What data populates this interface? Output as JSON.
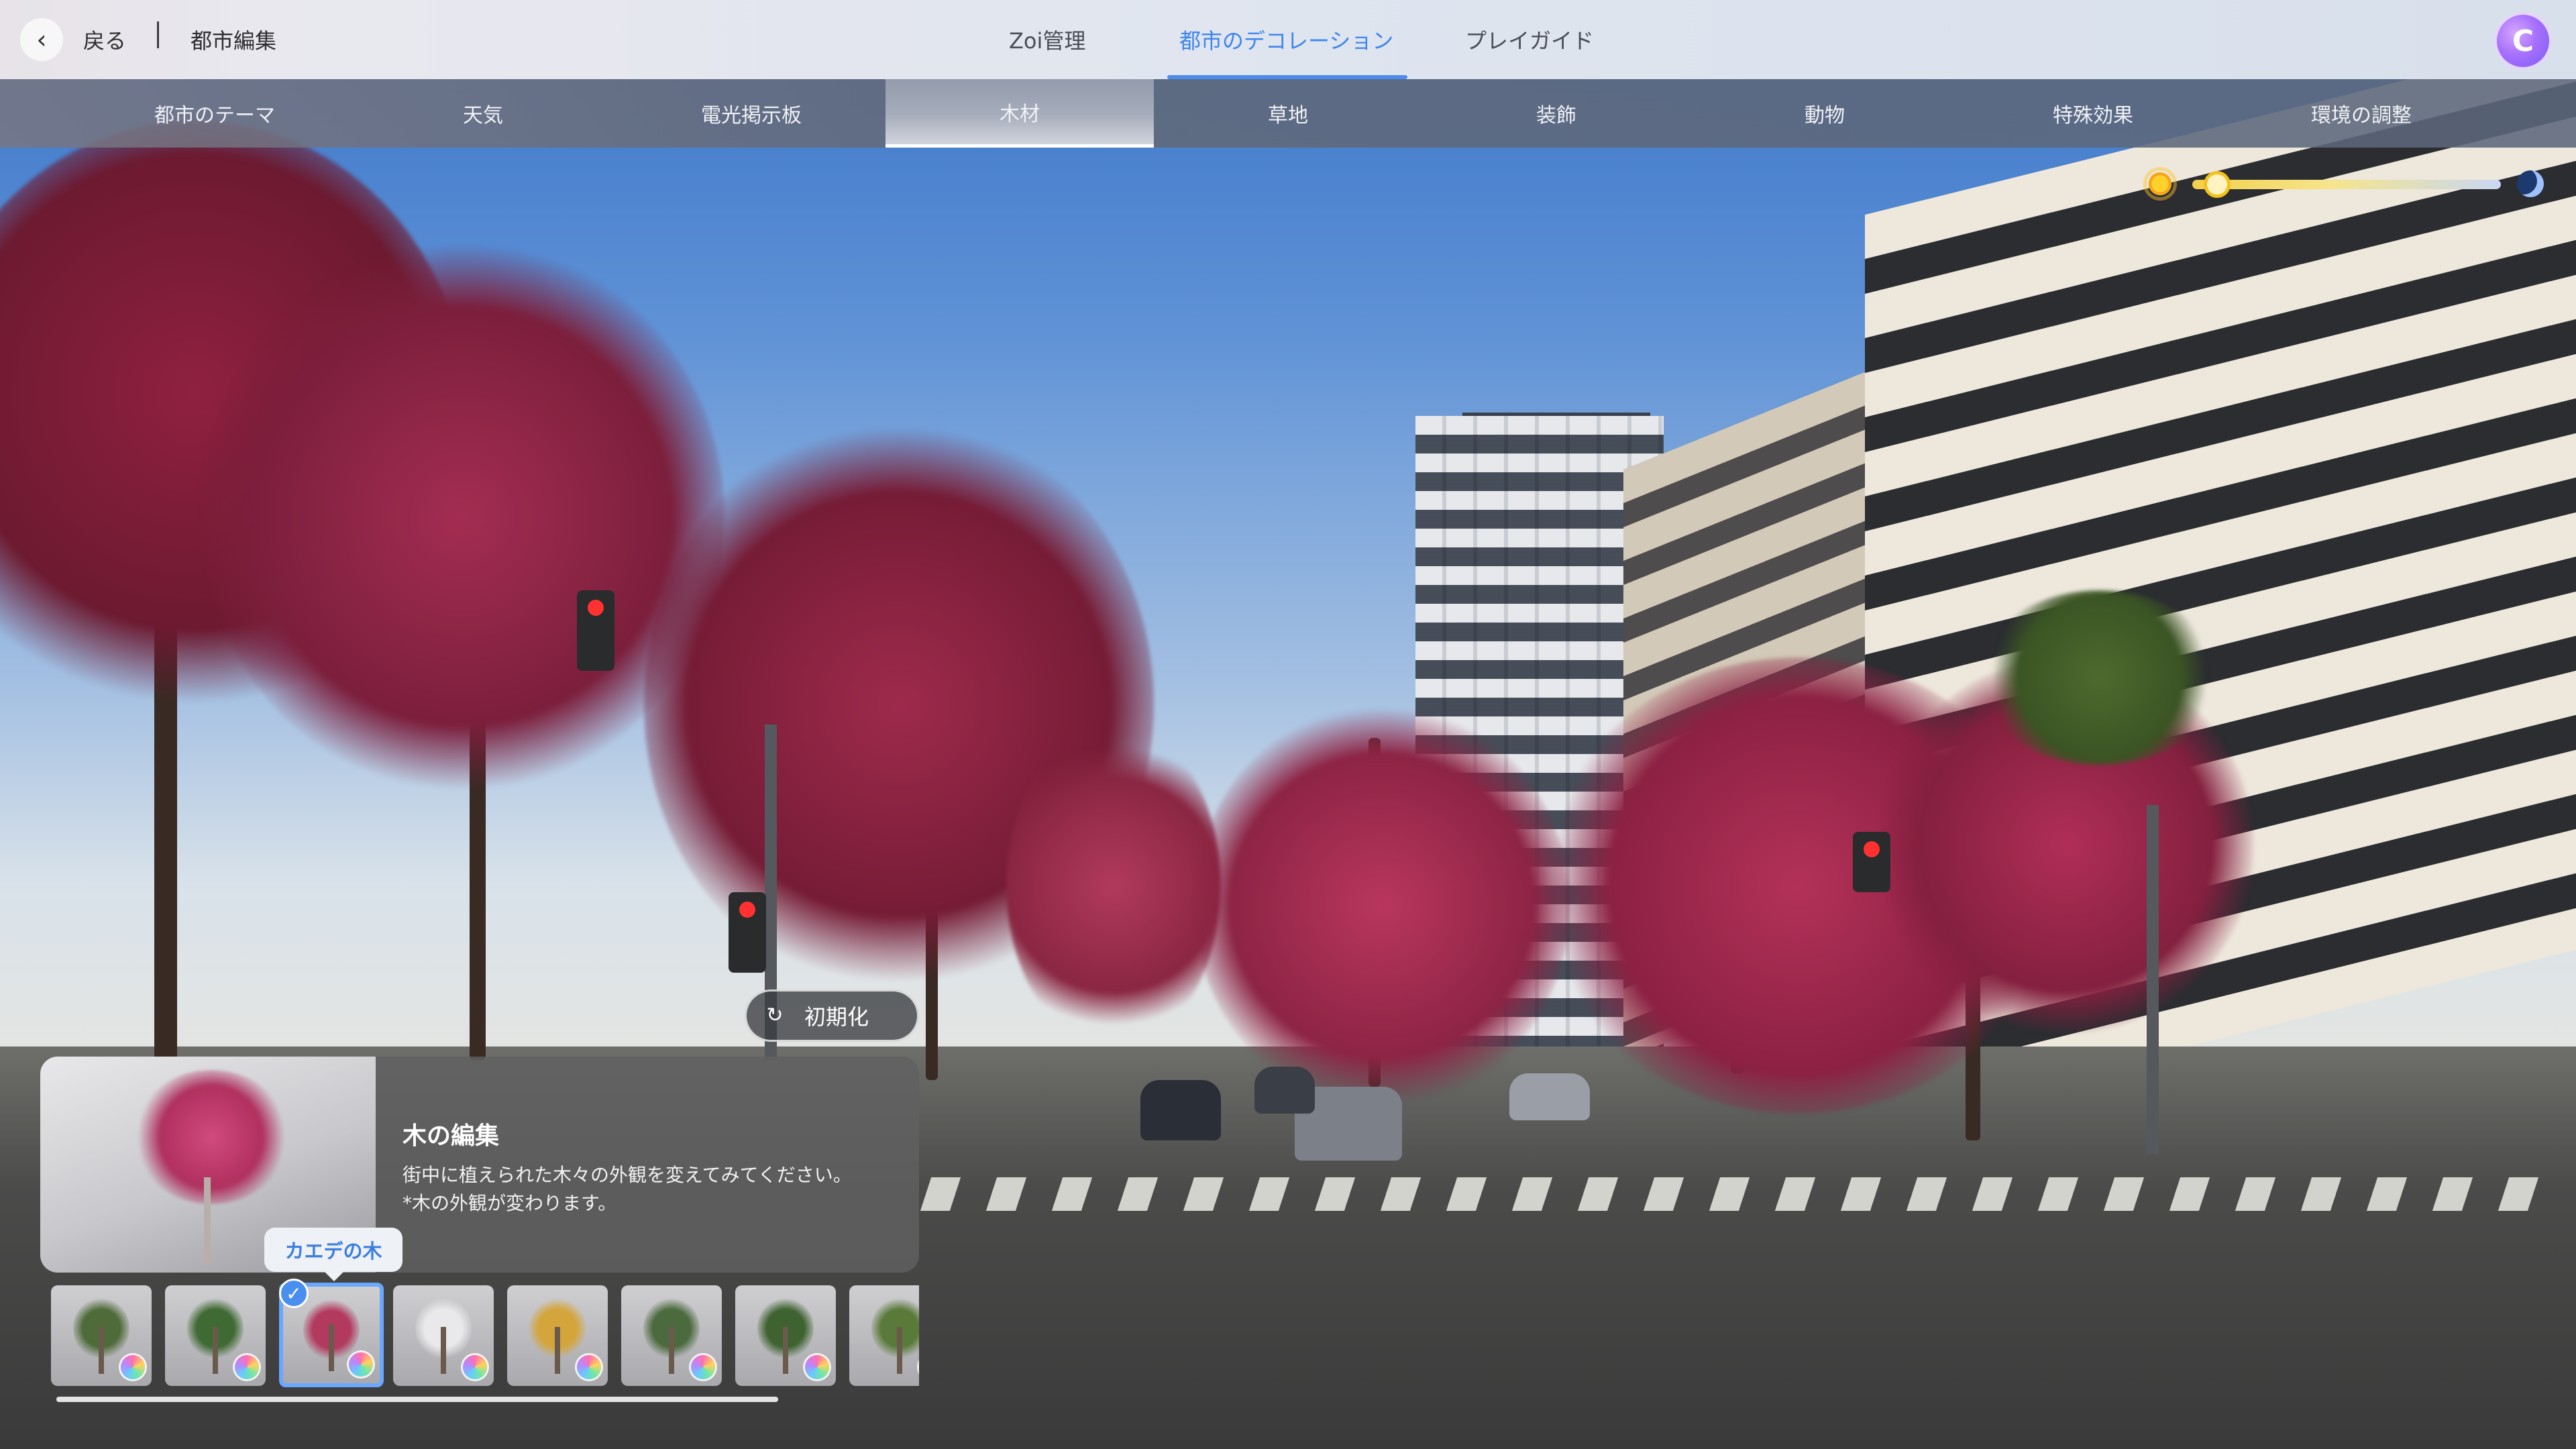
{
  "header": {
    "back_label": "戻る",
    "page_title": "都市編集",
    "tabs": [
      {
        "label": "Zoi管理",
        "active": false
      },
      {
        "label": "都市のデコレーション",
        "active": true
      },
      {
        "label": "プレイガイド",
        "active": false
      }
    ],
    "accent_color": "#3f86ee"
  },
  "categories": [
    {
      "label": "都市のテーマ",
      "active": false
    },
    {
      "label": "天気",
      "active": false
    },
    {
      "label": "電光掲示板",
      "active": false
    },
    {
      "label": "木材",
      "active": true
    },
    {
      "label": "草地",
      "active": false
    },
    {
      "label": "装飾",
      "active": false
    },
    {
      "label": "動物",
      "active": false
    },
    {
      "label": "特殊効果",
      "active": false
    },
    {
      "label": "環境の調整",
      "active": false
    }
  ],
  "time_of_day": {
    "left_icon": "sun-icon",
    "right_icon": "moon-icon",
    "level": 0.04
  },
  "reset_button": {
    "label": "初期化",
    "icon": "refresh-icon"
  },
  "edit_panel": {
    "title": "木の編集",
    "description": "街中に植えられた木々の外観を変えてみてください。",
    "note": "*木の外観が変わります。"
  },
  "tooltip": {
    "label": "カエデの木"
  },
  "tree_items": [
    {
      "icon": "palm-tree-icon",
      "color": "#4f6b3a",
      "selected": false
    },
    {
      "icon": "green-tree-icon",
      "color": "#3f6a33",
      "selected": false
    },
    {
      "icon": "maple-tree-icon",
      "color": "#b23a5e",
      "selected": true
    },
    {
      "icon": "white-blossom-tree-icon",
      "color": "#e9e9ec",
      "selected": false
    },
    {
      "icon": "golden-tree-icon",
      "color": "#d4a53a",
      "selected": false
    },
    {
      "icon": "pine-tree-icon",
      "color": "#4b6a3e",
      "selected": false
    },
    {
      "icon": "cypress-tree-icon",
      "color": "#3e6230",
      "selected": false
    },
    {
      "icon": "bamboo-icon",
      "color": "#5a7a3a",
      "selected": false
    }
  ],
  "item_strip": {
    "scroll_fraction": 1.0
  }
}
